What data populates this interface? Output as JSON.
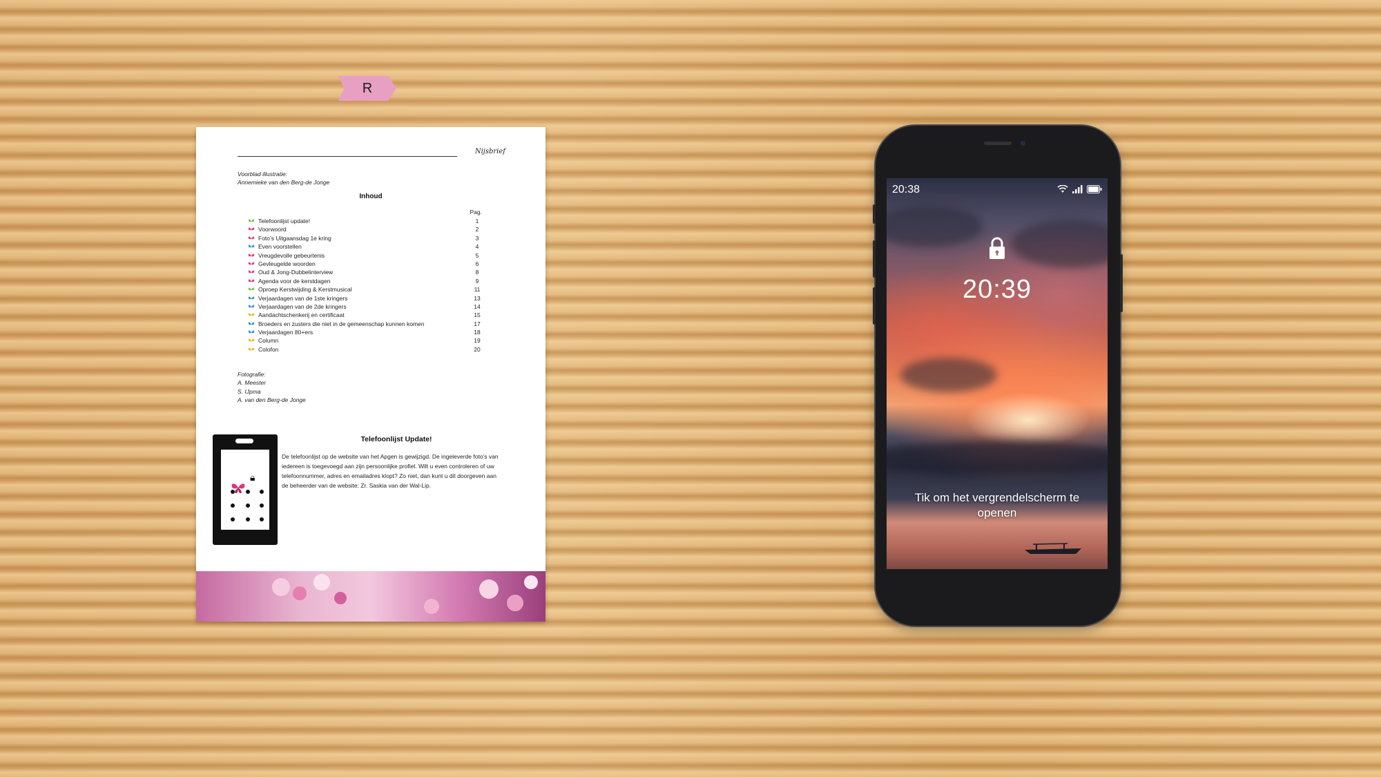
{
  "bookmark": {
    "label": "R"
  },
  "document": {
    "header_brand": "Nijsbrief",
    "credit_label": "Voorblad illustratie:",
    "credit_name": "Annemieke van den Berg-de Jonge",
    "toc_title": "Inhoud",
    "toc_page_header": "Pag.",
    "toc": [
      {
        "label": "Telefoonlijst update!",
        "page": "1",
        "color": "#7fc24a"
      },
      {
        "label": "Voorwoord",
        "page": "2",
        "color": "#e33a7c"
      },
      {
        "label": "Foto’s Uitgaansdag 1e kring",
        "page": "3",
        "color": "#e33a7c"
      },
      {
        "label": "Even voorstellen",
        "page": "4",
        "color": "#3a8fd0"
      },
      {
        "label": "Vreugdevolle gebeurtenis",
        "page": "5",
        "color": "#e33a7c"
      },
      {
        "label": "Gevleugelde woorden",
        "page": "6",
        "color": "#e33a7c"
      },
      {
        "label": "Oud & Jong-Dubbelinterview",
        "page": "8",
        "color": "#e33a7c"
      },
      {
        "label": "Agenda voor de kerstdagen",
        "page": "9",
        "color": "#e33a7c"
      },
      {
        "label": "Oproep Kerstwijding & Kerstmusical",
        "page": "11",
        "color": "#7fc24a"
      },
      {
        "label": "Verjaardagen van de 1ste kringers",
        "page": "13",
        "color": "#3a8fd0"
      },
      {
        "label": "Verjaardagen van de 2de kringers",
        "page": "14",
        "color": "#3a8fd0"
      },
      {
        "label": "Aandachtschenkerij en certificaat",
        "page": "15",
        "color": "#e8b820"
      },
      {
        "label": "Broeders en zusters die niet in de gemeenschap kunnen komen",
        "page": "17",
        "color": "#3a8fd0"
      },
      {
        "label": "Verjaardagen 80+ers",
        "page": "18",
        "color": "#3a8fd0"
      },
      {
        "label": "Column",
        "page": "19",
        "color": "#e8b820"
      },
      {
        "label": "Colofon",
        "page": "20",
        "color": "#e8b820"
      }
    ],
    "photo_label": "Fotografie:",
    "photographers": [
      "A. Meester",
      "S. IJpma",
      "A. van den Berg-de Jonge"
    ],
    "article_title": "Telefoonlijst Update!",
    "article_body": "De telefoonlijst op de website van het Apgen is gewijzigd. De ingeleverde foto’s van iedereen is toegevoegd aan zijn persoonlijke profiel. Wilt u even controleren of uw telefoonnummer, adres en emailadres klopt? Zo niet, dan kunt u dit doorgeven aan de beheerder van de website: Zr. Saskia van der Wal-Lip."
  },
  "phone": {
    "status_time": "20:38",
    "status_icons": [
      "wifi-icon",
      "signal-icon",
      "battery-icon"
    ],
    "lock_time": "20:39",
    "unlock_hint": "Tik om het vergrendelscherm te openen"
  }
}
